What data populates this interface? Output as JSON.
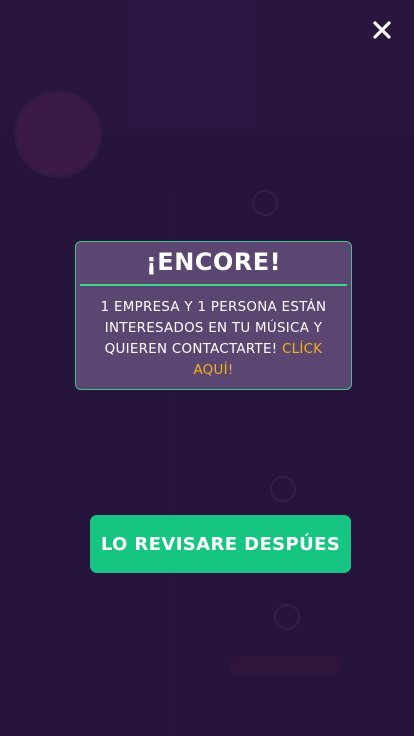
{
  "dialog": {
    "title": "¡ENCORE!",
    "message": "1 EMPRESA Y 1 PERSONA ESTÁN INTERESADOS EN TU MÚSICA Y QUIEREN CONTACTARTE!",
    "link_label": "CLÍCK AQUÍ!"
  },
  "actions": {
    "later_label": "LO REVISARE DESPÚES"
  },
  "icons": {
    "close": "close-icon"
  },
  "colors": {
    "accent_green": "#17c582",
    "link_yellow": "#f2b21c",
    "modal_bg": "#5a4670",
    "overlay": "#220e38"
  }
}
